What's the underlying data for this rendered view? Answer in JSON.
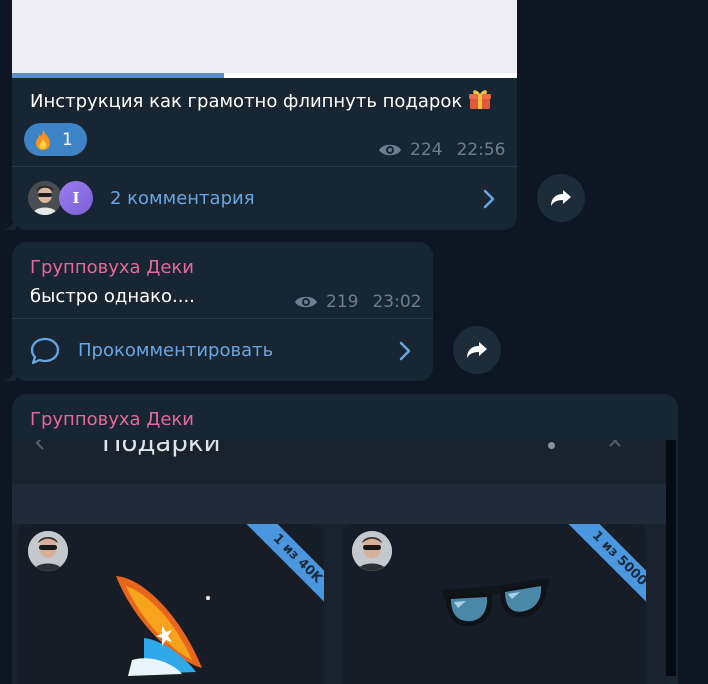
{
  "messages": [
    {
      "caption": "Инструкция как грамотно флипнуть подарок",
      "caption_emoji": "gift-emoji",
      "video_progress": 0.42,
      "reaction": {
        "emoji": "fire-emoji",
        "count": "1"
      },
      "views": "224",
      "time": "22:56",
      "comment_avatars": [
        {
          "type": "photo"
        },
        {
          "type": "letter",
          "letter": "I"
        }
      ],
      "comments_label": "2 комментария"
    },
    {
      "sender": "Групповуха Деки",
      "text": "быстро однако....",
      "views": "219",
      "time": "23:02",
      "comment_label": "Прокомментировать"
    },
    {
      "sender": "Групповуха Деки",
      "screenshot": {
        "title": "Подарки",
        "cards": [
          {
            "ribbon": "1 из 40K",
            "item": "surfboard-gift"
          },
          {
            "ribbon": "1 из 5000",
            "item": "sunglasses-gift"
          }
        ]
      }
    }
  ],
  "colors": {
    "background": "#0e1621",
    "bubble": "#182533",
    "accent": "#69a6e1",
    "sender_name": "#e5689a",
    "meta": "#6d7f8f",
    "reaction": "#3d84c7",
    "ribbon": "#4a97e0"
  }
}
